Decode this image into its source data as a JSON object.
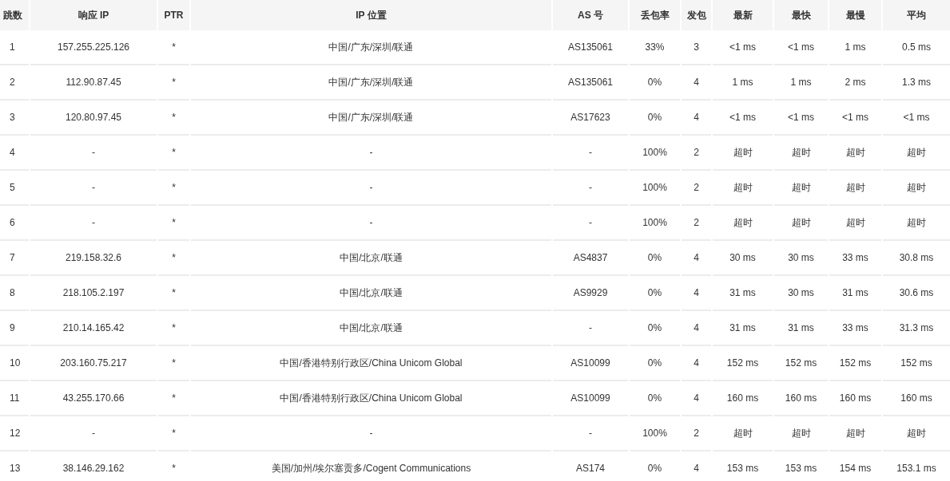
{
  "table": {
    "columns": [
      "跳数",
      "响应 IP",
      "PTR",
      "IP 位置",
      "AS 号",
      "丢包率",
      "发包",
      "最新",
      "最快",
      "最慢",
      "平均"
    ],
    "rows": [
      {
        "cells": [
          "1",
          "157.255.225.126",
          "*",
          "中国/广东/深圳/联通",
          "AS135061",
          "33%",
          "3",
          "<1 ms",
          "<1 ms",
          "1 ms",
          "0.5 ms"
        ]
      },
      {
        "cells": [
          "2",
          "112.90.87.45",
          "*",
          "中国/广东/深圳/联通",
          "AS135061",
          "0%",
          "4",
          "1 ms",
          "1 ms",
          "2 ms",
          "1.3 ms"
        ]
      },
      {
        "cells": [
          "3",
          "120.80.97.45",
          "*",
          "中国/广东/深圳/联通",
          "AS17623",
          "0%",
          "4",
          "<1 ms",
          "<1 ms",
          "<1 ms",
          "<1 ms"
        ]
      },
      {
        "cells": [
          "4",
          "-",
          "*",
          "-",
          "-",
          "100%",
          "2",
          "超时",
          "超时",
          "超时",
          "超时"
        ]
      },
      {
        "cells": [
          "5",
          "-",
          "*",
          "-",
          "-",
          "100%",
          "2",
          "超时",
          "超时",
          "超时",
          "超时"
        ]
      },
      {
        "cells": [
          "6",
          "-",
          "*",
          "-",
          "-",
          "100%",
          "2",
          "超时",
          "超时",
          "超时",
          "超时"
        ]
      },
      {
        "cells": [
          "7",
          "219.158.32.6",
          "*",
          "中国/北京/联通",
          "AS4837",
          "0%",
          "4",
          "30 ms",
          "30 ms",
          "33 ms",
          "30.8 ms"
        ]
      },
      {
        "cells": [
          "8",
          "218.105.2.197",
          "*",
          "中国/北京/联通",
          "AS9929",
          "0%",
          "4",
          "31 ms",
          "30 ms",
          "31 ms",
          "30.6 ms"
        ]
      },
      {
        "cells": [
          "9",
          "210.14.165.42",
          "*",
          "中国/北京/联通",
          "-",
          "0%",
          "4",
          "31 ms",
          "31 ms",
          "33 ms",
          "31.3 ms"
        ]
      },
      {
        "cells": [
          "10",
          "203.160.75.217",
          "*",
          "中国/香港特别行政区/China Unicom Global",
          "AS10099",
          "0%",
          "4",
          "152 ms",
          "152 ms",
          "152 ms",
          "152 ms"
        ]
      },
      {
        "cells": [
          "11",
          "43.255.170.66",
          "*",
          "中国/香港特别行政区/China Unicom Global",
          "AS10099",
          "0%",
          "4",
          "160 ms",
          "160 ms",
          "160 ms",
          "160 ms"
        ]
      },
      {
        "cells": [
          "12",
          "-",
          "*",
          "-",
          "-",
          "100%",
          "2",
          "超时",
          "超时",
          "超时",
          "超时"
        ]
      },
      {
        "cells": [
          "13",
          "38.146.29.162",
          "*",
          "美国/加州/埃尔塞贡多/Cogent Communications",
          "AS174",
          "0%",
          "4",
          "153 ms",
          "153 ms",
          "154 ms",
          "153.1 ms"
        ]
      }
    ]
  }
}
